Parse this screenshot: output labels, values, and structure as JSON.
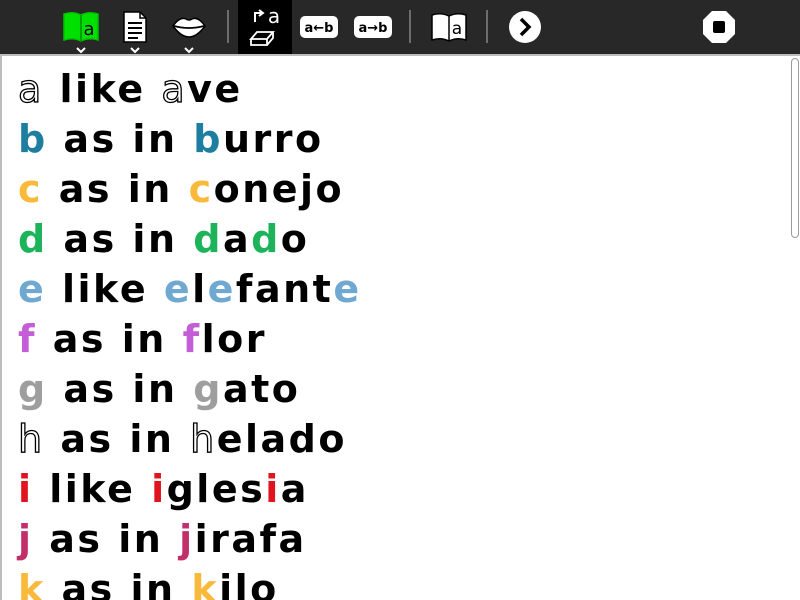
{
  "toolbar": {
    "icons": [
      "book-icon",
      "document-icon",
      "lips-icon",
      "edit-mode-icon",
      "a-to-b-left-icon",
      "a-to-b-right-icon",
      "read-book-icon",
      "next-icon",
      "stop-icon"
    ],
    "book_icon_letter": "a",
    "edit_letter": "a",
    "left_arrow_text": "a←b",
    "right_arrow_text": "a→b",
    "read_book_letter": "a",
    "active_color": "#00e000"
  },
  "lines": [
    {
      "segments": [
        {
          "t": "a",
          "s": "outline"
        },
        {
          "t": " like "
        },
        {
          "t": "a",
          "s": "outline"
        },
        {
          "t": "ve"
        }
      ]
    },
    {
      "segments": [
        {
          "t": "b",
          "c": "#1e7ea0"
        },
        {
          "t": " as in "
        },
        {
          "t": "b",
          "c": "#1e7ea0"
        },
        {
          "t": "urro"
        }
      ]
    },
    {
      "segments": [
        {
          "t": "c",
          "c": "#f9b93a"
        },
        {
          "t": " as in "
        },
        {
          "t": "c",
          "c": "#f9b93a"
        },
        {
          "t": "onejo"
        }
      ]
    },
    {
      "segments": [
        {
          "t": "d",
          "c": "#1db35a"
        },
        {
          "t": " as in "
        },
        {
          "t": "d",
          "c": "#1db35a"
        },
        {
          "t": "a"
        },
        {
          "t": "d",
          "c": "#1db35a"
        },
        {
          "t": "o"
        }
      ]
    },
    {
      "segments": [
        {
          "t": "e",
          "c": "#6fa8d0"
        },
        {
          "t": " like "
        },
        {
          "t": "e",
          "c": "#6fa8d0"
        },
        {
          "t": "l"
        },
        {
          "t": "e",
          "c": "#6fa8d0"
        },
        {
          "t": "fant"
        },
        {
          "t": "e",
          "c": "#6fa8d0"
        }
      ]
    },
    {
      "segments": [
        {
          "t": "f",
          "c": "#c35ed6"
        },
        {
          "t": " as in "
        },
        {
          "t": "f",
          "c": "#c35ed6"
        },
        {
          "t": "lor"
        }
      ]
    },
    {
      "segments": [
        {
          "t": "g",
          "c": "#9e9e9e"
        },
        {
          "t": " as in "
        },
        {
          "t": "g",
          "c": "#9e9e9e"
        },
        {
          "t": "ato"
        }
      ]
    },
    {
      "segments": [
        {
          "t": "h",
          "s": "outline"
        },
        {
          "t": " as in "
        },
        {
          "t": "h",
          "s": "outline"
        },
        {
          "t": "elado"
        }
      ]
    },
    {
      "segments": [
        {
          "t": "i",
          "c": "#e0141e"
        },
        {
          "t": " like "
        },
        {
          "t": "i",
          "c": "#e0141e"
        },
        {
          "t": "gles"
        },
        {
          "t": "i",
          "c": "#e0141e"
        },
        {
          "t": "a"
        }
      ]
    },
    {
      "segments": [
        {
          "t": "j",
          "c": "#c2306c"
        },
        {
          "t": " as in "
        },
        {
          "t": "j",
          "c": "#c2306c"
        },
        {
          "t": "irafa"
        }
      ]
    },
    {
      "segments": [
        {
          "t": "k",
          "c": "#f9b93a"
        },
        {
          "t": " as in "
        },
        {
          "t": "k",
          "c": "#f9b93a"
        },
        {
          "t": "ilo"
        }
      ]
    }
  ],
  "scrollbar": {
    "position_fraction": 0.0,
    "visible_fraction": 0.33
  }
}
